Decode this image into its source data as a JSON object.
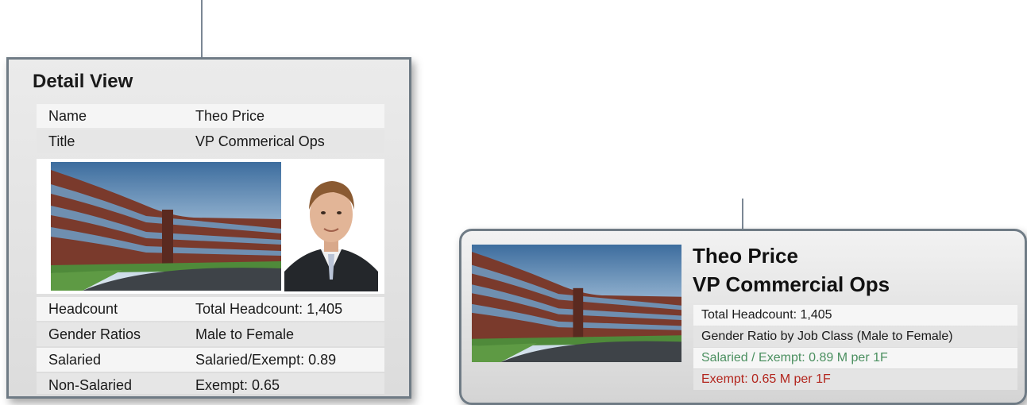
{
  "detail_view": {
    "title": "Detail View",
    "rows_top": [
      {
        "label": "Name",
        "value": "Theo Price"
      },
      {
        "label": "Title",
        "value": "VP Commerical Ops"
      }
    ],
    "rows_bottom": [
      {
        "label": "Headcount",
        "value": "Total Headcount: 1,405"
      },
      {
        "label": "Gender Ratios",
        "value": "Male to Female"
      },
      {
        "label": "Salaried",
        "value": "Salaried/Exempt: 0.89"
      },
      {
        "label": "Non-Salaried",
        "value": "Exempt: 0.65"
      }
    ]
  },
  "summary": {
    "name": "Theo Price",
    "title": "VP Commercial Ops",
    "rows": [
      {
        "text": "Total Headcount: 1,405"
      },
      {
        "text": "Gender Ratio by Job Class (Male to Female)"
      },
      {
        "text": "Salaried / Exempt: 0.89 M per 1F"
      },
      {
        "text": "Exempt: 0.65 M per 1F"
      }
    ]
  },
  "colors": {
    "salaried_green": "#4a8f5f",
    "exempt_red": "#b3261e",
    "border": "#6f7b85"
  }
}
